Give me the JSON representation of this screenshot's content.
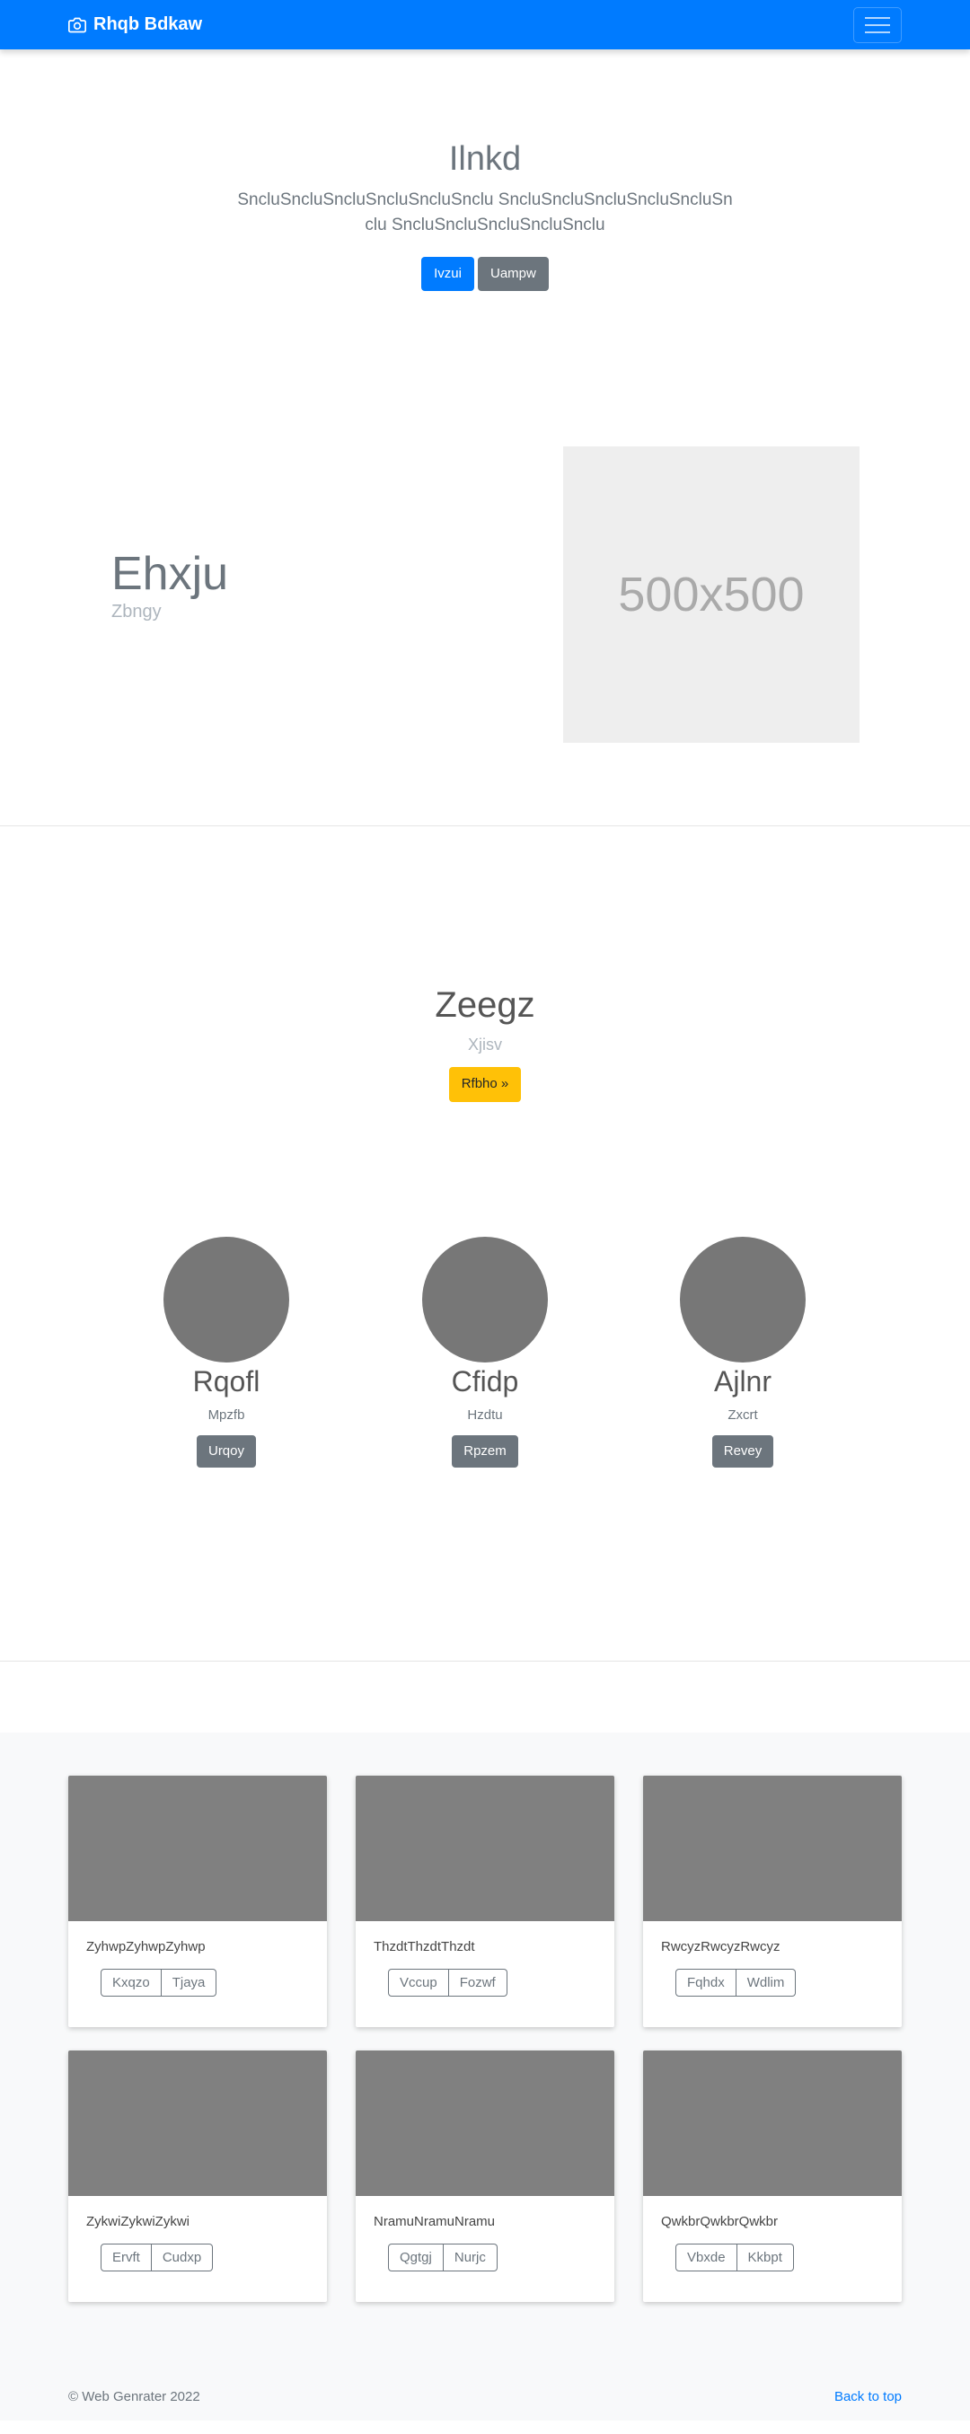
{
  "navbar": {
    "brand": "Rhqb Bdkaw",
    "brand_icon": "camera-icon",
    "toggler_icon": "hamburger-menu-icon",
    "background_color": "#007bff"
  },
  "hero": {
    "title": "Ilnkd",
    "lead": "SncluSncluSncluSncluSncluSnclu SncluSncluSncluSncluSncluSnclu SncluSncluSncluSncluSnclu",
    "primary_button": "Ivzui",
    "secondary_button": "Uampw"
  },
  "feature": {
    "heading": "Ehxju",
    "subheading": "Zbngy",
    "image_placeholder": "500x500"
  },
  "center": {
    "title": "Zeegz",
    "subtitle": "Xjisv",
    "button": "Rfbho »"
  },
  "people": [
    {
      "name": "Rqofl",
      "role": "Mpzfb",
      "button": "Urqoy"
    },
    {
      "name": "Cfidp",
      "role": "Hzdtu",
      "button": "Rpzem"
    },
    {
      "name": "Ajlnr",
      "role": "Zxcrt",
      "button": "Revey"
    }
  ],
  "cards": [
    {
      "text": "ZyhwpZyhwpZyhwp",
      "btn1": "Kxqzo",
      "btn2": "Tjaya"
    },
    {
      "text": "ThzdtThzdtThzdt",
      "btn1": "Vccup",
      "btn2": "Fozwf"
    },
    {
      "text": "RwcyzRwcyzRwcyz",
      "btn1": "Fqhdx",
      "btn2": "Wdlim"
    },
    {
      "text": "ZykwiZykwiZykwi",
      "btn1": "Ervft",
      "btn2": "Cudxp"
    },
    {
      "text": "NramuNramuNramu",
      "btn1": "Qgtgj",
      "btn2": "Nurjc"
    },
    {
      "text": "QwkbrQwkbrQwkbr",
      "btn1": "Vbxde",
      "btn2": "Kkbpt"
    }
  ],
  "footer": {
    "copyright": "© Web Genrater 2022",
    "back_to_top": "Back to top"
  }
}
